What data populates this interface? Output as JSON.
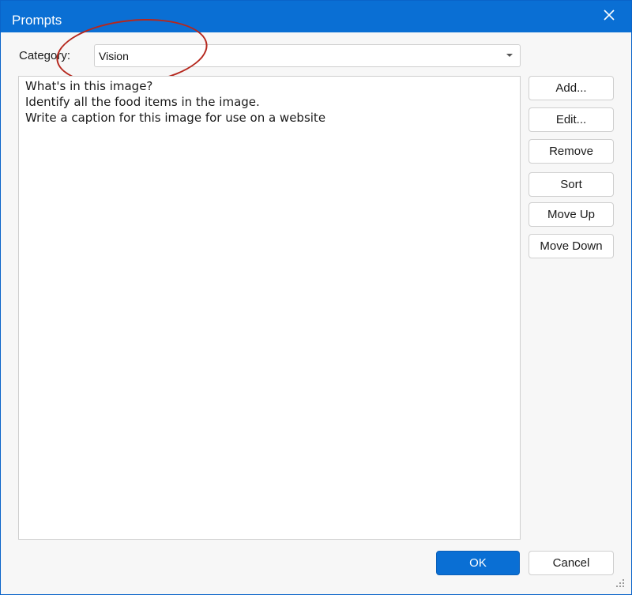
{
  "window": {
    "title": "Prompts",
    "close_icon": "close-icon"
  },
  "category": {
    "label": "Category:",
    "selected": "Vision"
  },
  "prompts": [
    "What's in this image?",
    "Identify all the food items in the image.",
    "Write a caption for this image for use on a website"
  ],
  "buttons": {
    "add": "Add...",
    "edit": "Edit...",
    "remove": "Remove",
    "sort": "Sort",
    "move_up": "Move Up",
    "move_down": "Move Down",
    "ok": "OK",
    "cancel": "Cancel"
  },
  "colors": {
    "titlebar": "#0a6fd4",
    "primary_button": "#0a6fd4",
    "annotation": "#b5271d"
  }
}
